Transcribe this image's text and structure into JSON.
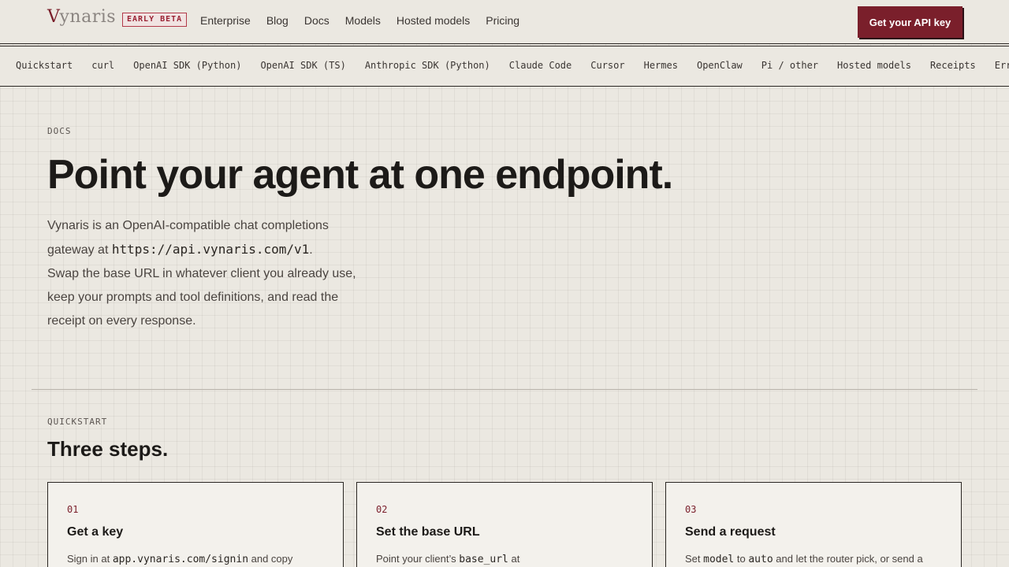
{
  "header": {
    "logo": "Vynaris",
    "badge": "EARLY BETA",
    "nav": [
      "Enterprise",
      "Blog",
      "Docs",
      "Models",
      "Hosted models",
      "Pricing"
    ],
    "cta": "Get your API key"
  },
  "subnav": [
    "Quickstart",
    "curl",
    "OpenAI SDK (Python)",
    "OpenAI SDK (TS)",
    "Anthropic SDK (Python)",
    "Claude Code",
    "Cursor",
    "Hermes",
    "OpenClaw",
    "Pi / other",
    "Hosted models",
    "Receipts",
    "Err"
  ],
  "hero": {
    "eyebrow": "DOCS",
    "title": "Point your agent at one endpoint.",
    "desc_line1": "Vynaris is an OpenAI-compatible chat completions",
    "desc_prefix": "gateway at ",
    "desc_url": "https://api.vynaris.com/v1",
    "desc_suffix": ".",
    "desc_line3": "Swap the base URL in whatever client you already use,",
    "desc_line4": "keep your prompts and tool definitions, and read the",
    "desc_line5": "receipt on every response."
  },
  "quickstart": {
    "eyebrow": "QUICKSTART",
    "title": "Three steps.",
    "steps": [
      {
        "num": "01",
        "title": "Get a key",
        "d1": "Sign in at ",
        "code1": "app.vynaris.com/signin",
        "d2": " and copy"
      },
      {
        "num": "02",
        "title": "Set the base URL",
        "d1": "Point your client’s ",
        "code1": "base_url",
        "d2": " at"
      },
      {
        "num": "03",
        "title": "Send a request",
        "d1": "Set ",
        "code1": "model",
        "d2": " to ",
        "code2": "auto",
        "d3": " and let the router pick, or send a"
      }
    ]
  }
}
